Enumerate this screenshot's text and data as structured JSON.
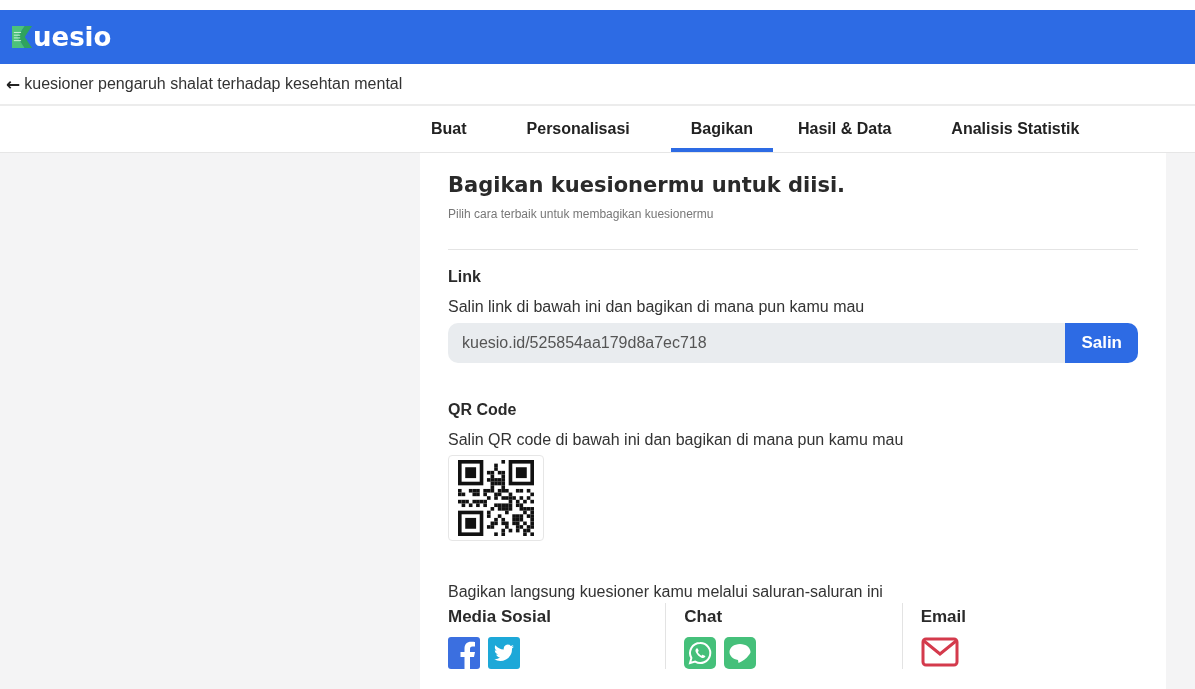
{
  "header": {
    "logo_text": "uesio"
  },
  "breadcrumb": {
    "back_icon": "←",
    "title": "kuesioner pengaruh shalat terhadap kesehtan mental"
  },
  "tabs": [
    {
      "label": "Buat",
      "selected": false
    },
    {
      "label": "Personalisasi",
      "selected": false
    },
    {
      "label": "Bagikan",
      "selected": true
    },
    {
      "label": "Hasil & Data",
      "selected": false
    },
    {
      "label": "Analisis Statistik",
      "selected": false
    }
  ],
  "card": {
    "title": "Bagikan kuesionermu untuk diisi.",
    "subtitle": "Pilih cara terbaik untuk membagikan kuesionermu",
    "link": {
      "heading": "Link",
      "description": "Salin link di bawah ini dan bagikan di mana pun kamu mau",
      "value": "kuesio.id/525854aa179d8a7ec718",
      "button": "Salin"
    },
    "qr": {
      "heading": "QR Code",
      "description": "Salin QR code di bawah ini dan bagikan di mana pun kamu mau"
    },
    "channels": {
      "intro": "Bagikan langsung kuesioner kamu melalui saluran-saluran ini",
      "groups": [
        {
          "heading": "Media Sosial",
          "icons": [
            {
              "kind": "facebook"
            },
            {
              "kind": "twitter"
            }
          ]
        },
        {
          "heading": "Chat",
          "icons": [
            {
              "kind": "whatsapp"
            },
            {
              "kind": "line"
            }
          ]
        },
        {
          "heading": "Email",
          "icons": [
            {
              "kind": "email"
            }
          ]
        }
      ]
    }
  }
}
